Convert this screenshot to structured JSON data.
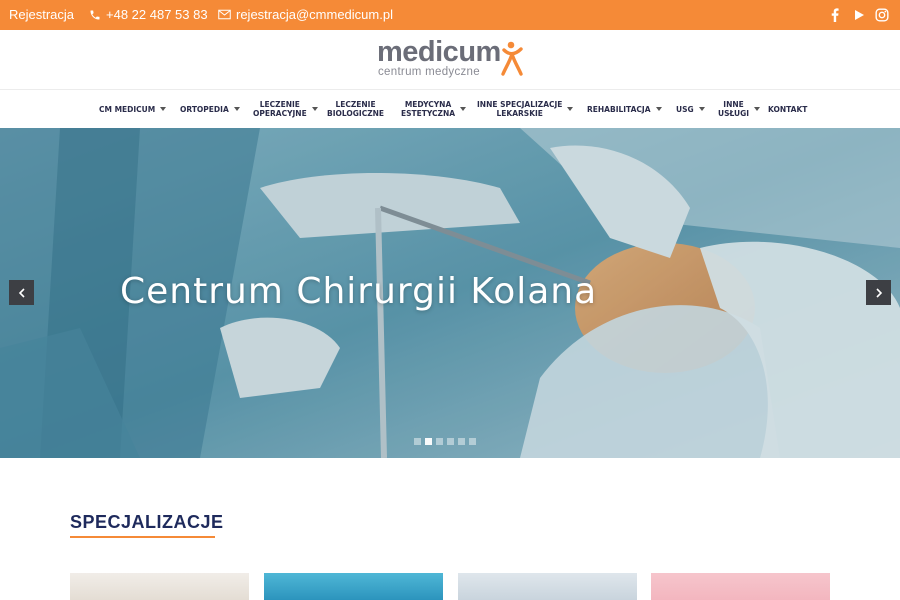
{
  "topbar": {
    "registration_label": "Rejestracja",
    "phone": "+48 22 487 53 83",
    "email": "rejestracja@cmmedicum.pl",
    "icons": [
      "phone-icon",
      "mail-icon",
      "facebook-icon",
      "youtube-icon",
      "instagram-icon"
    ],
    "background_color": "#f58a37"
  },
  "logo": {
    "name": "medicum",
    "tagline": "centrum medyczne",
    "accent_color": "#f58a37"
  },
  "nav": {
    "items": [
      {
        "line1": "CM MEDICUM",
        "line2": "",
        "dropdown": true
      },
      {
        "line1": "ORTOPEDIA",
        "line2": "",
        "dropdown": true
      },
      {
        "line1": "LECZENIE",
        "line2": "OPERACYJNE",
        "dropdown": true
      },
      {
        "line1": "LECZENIE",
        "line2": "BIOLOGICZNE",
        "dropdown": false
      },
      {
        "line1": "MEDYCYNA",
        "line2": "ESTETYCZNA",
        "dropdown": true
      },
      {
        "line1": "INNE SPECJALIZACJE",
        "line2": "LEKARSKIE",
        "dropdown": true
      },
      {
        "line1": "REHABILITACJA",
        "line2": "",
        "dropdown": true
      },
      {
        "line1": "USG",
        "line2": "",
        "dropdown": true
      },
      {
        "line1": "INNE",
        "line2": "USŁUGI",
        "dropdown": true
      },
      {
        "line1": "KONTAKT",
        "line2": "",
        "dropdown": false
      }
    ]
  },
  "hero": {
    "title": "Centrum Chirurgii Kolana",
    "slide_count": 6,
    "active_slide": 2
  },
  "specializations": {
    "heading": "SPECJALIZACJE",
    "cards": 4
  }
}
